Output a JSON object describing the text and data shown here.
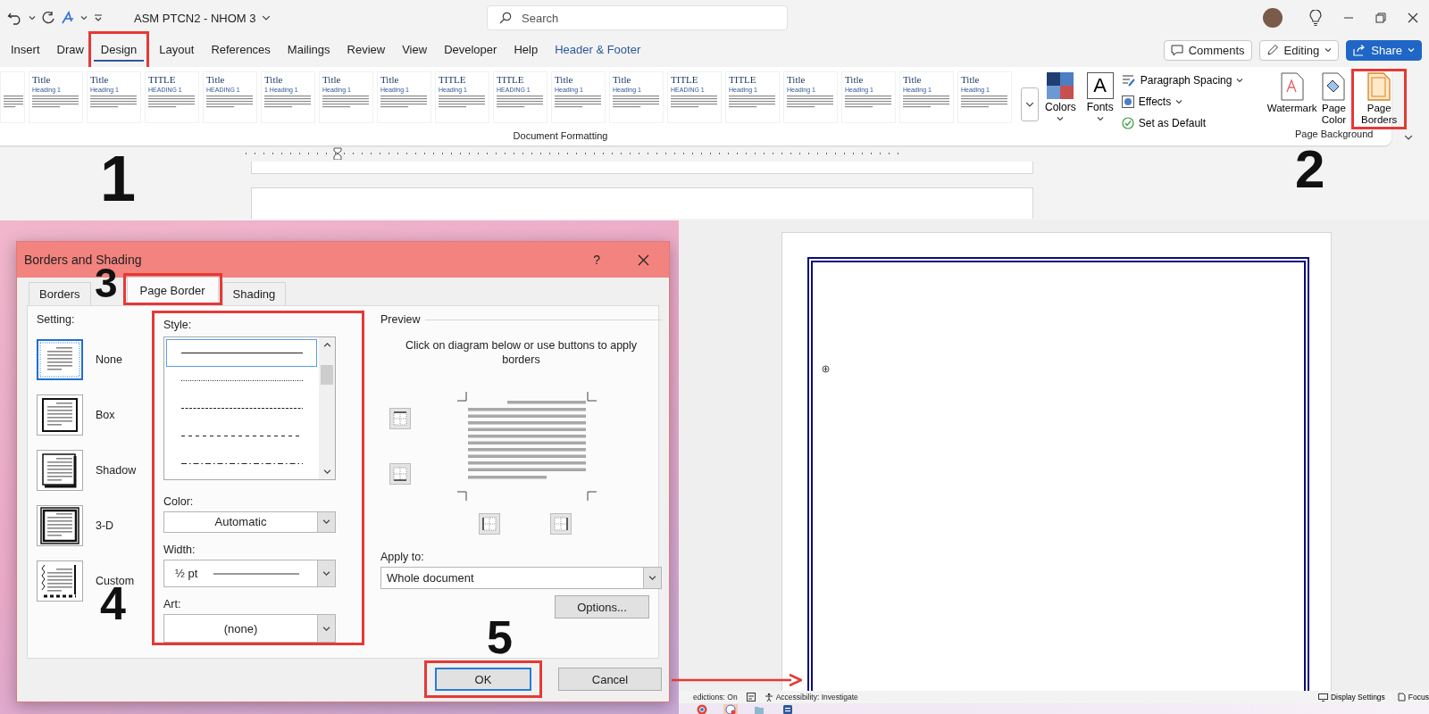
{
  "title_bar": {
    "document_title": "ASM PTCN2 - NHOM 3",
    "search": {
      "placeholder": "Search"
    }
  },
  "ribbon_tabs": [
    {
      "label": "Insert",
      "selected": false,
      "highlighted": false,
      "kind": "standard"
    },
    {
      "label": "Draw",
      "selected": false,
      "highlighted": false,
      "kind": "standard"
    },
    {
      "label": "Design",
      "selected": true,
      "highlighted": true,
      "kind": "standard"
    },
    {
      "label": "Layout",
      "selected": false,
      "highlighted": false,
      "kind": "standard"
    },
    {
      "label": "References",
      "selected": false,
      "highlighted": false,
      "kind": "standard"
    },
    {
      "label": "Mailings",
      "selected": false,
      "highlighted": false,
      "kind": "standard"
    },
    {
      "label": "Review",
      "selected": false,
      "highlighted": false,
      "kind": "standard"
    },
    {
      "label": "View",
      "selected": false,
      "highlighted": false,
      "kind": "standard"
    },
    {
      "label": "Developer",
      "selected": false,
      "highlighted": false,
      "kind": "standard"
    },
    {
      "label": "Help",
      "selected": false,
      "highlighted": false,
      "kind": "standard"
    },
    {
      "label": "Header & Footer",
      "selected": false,
      "highlighted": false,
      "kind": "contextual"
    }
  ],
  "header_buttons": [
    {
      "label": "Comments",
      "kind": "comments"
    },
    {
      "label": "Editing",
      "kind": "editing"
    },
    {
      "label": "Share",
      "kind": "share"
    }
  ],
  "style_gallery": {
    "group_label": "Document Formatting",
    "styles": [
      {
        "kind": "partial"
      },
      {
        "kind": "full",
        "title": "Title",
        "heading": "Heading 1"
      },
      {
        "kind": "full",
        "title": "Title",
        "heading": "Heading 1"
      },
      {
        "kind": "full",
        "title": "TITLE",
        "heading": "HEADING 1"
      },
      {
        "kind": "full",
        "title": "Title",
        "heading": "HEADING 1"
      },
      {
        "kind": "full",
        "title": "Title",
        "heading": "1 Heading 1"
      },
      {
        "kind": "full",
        "title": "Title",
        "heading": "Heading 1"
      },
      {
        "kind": "full",
        "title": "Title",
        "heading": "Heading 1"
      },
      {
        "kind": "full",
        "title": "TITLE",
        "heading": "Heading 1"
      },
      {
        "kind": "full",
        "title": "TITLE",
        "heading": "HEADING 1"
      },
      {
        "kind": "full",
        "title": "Title",
        "heading": "Heading 1"
      },
      {
        "kind": "full",
        "title": "Title",
        "heading": "Heading 1"
      },
      {
        "kind": "full",
        "title": "TITLE",
        "heading": "HEADING 1"
      },
      {
        "kind": "full",
        "title": "TITLE",
        "heading": "Heading 1"
      },
      {
        "kind": "full",
        "title": "Title",
        "heading": "Heading 1"
      },
      {
        "kind": "full",
        "title": "Title",
        "heading": "Heading 1"
      },
      {
        "kind": "full",
        "title": "Title",
        "heading": "Heading 1"
      },
      {
        "kind": "full",
        "title": "Title",
        "heading": "Heading 1"
      }
    ]
  },
  "theme_buttons": [
    {
      "label": "Colors",
      "kind": "colors"
    },
    {
      "label": "Fonts",
      "kind": "fonts",
      "glyph": "A"
    }
  ],
  "format_options": [
    {
      "label": "Paragraph Spacing",
      "kind": "spacing",
      "dropdown": true
    },
    {
      "label": "Effects",
      "kind": "effects",
      "dropdown": true
    },
    {
      "label": "Set as Default",
      "kind": "default",
      "dropdown": false
    }
  ],
  "page_background": {
    "group_label": "Page Background",
    "buttons": [
      {
        "label": "Watermark",
        "kind": "watermark",
        "highlighted": false
      },
      {
        "label": "Page Color",
        "kind": "color",
        "highlighted": false
      },
      {
        "label": "Page Borders",
        "kind": "borders",
        "highlighted": true
      }
    ]
  },
  "dialog": {
    "title": "Borders and Shading",
    "help_glyph": "?",
    "tabs": [
      {
        "label": "Borders",
        "selected": false,
        "highlighted": false
      },
      {
        "label": "Page Border",
        "selected": true,
        "highlighted": true
      },
      {
        "label": "Shading",
        "selected": false,
        "highlighted": false
      }
    ],
    "setting": {
      "label": "Setting:",
      "options": [
        {
          "label": "None",
          "kind": "none",
          "selected": true
        },
        {
          "label": "Box",
          "kind": "box",
          "selected": false
        },
        {
          "label": "Shadow",
          "kind": "shadow",
          "selected": false
        },
        {
          "label": "3-D",
          "kind": "threed",
          "selected": false
        },
        {
          "label": "Custom",
          "kind": "custom",
          "selected": false
        }
      ]
    },
    "style_group": {
      "highlighted": true,
      "style_label": "Style:",
      "line_styles": [
        {
          "kind": "solid",
          "selected": true
        },
        {
          "kind": "dotted",
          "selected": false
        },
        {
          "kind": "fine-dashed",
          "selected": false
        },
        {
          "kind": "dashed",
          "selected": false
        },
        {
          "kind": "dash-dot",
          "selected": false
        }
      ],
      "color_label": "Color:",
      "color_value": "Automatic",
      "width_label": "Width:",
      "width_value": "½ pt",
      "art_label": "Art:",
      "art_value": "(none)"
    },
    "preview": {
      "label": "Preview",
      "instructions": "Click on diagram below or use buttons to apply borders"
    },
    "apply_to": {
      "label": "Apply to:",
      "value": "Whole document"
    },
    "buttons": [
      {
        "label": "Options...",
        "kind": "options",
        "highlighted": false,
        "default": false
      },
      {
        "label": "OK",
        "kind": "ok",
        "highlighted": true,
        "default": true
      },
      {
        "label": "Cancel",
        "kind": "cancel",
        "highlighted": false,
        "default": false
      }
    ]
  },
  "step_markers": [
    "1",
    "2",
    "3",
    "4",
    "5"
  ],
  "status_bar": {
    "left_items": [
      {
        "text": "edictions: On",
        "kind": "predictions"
      },
      {
        "text": "Accessibility: Investigate",
        "kind": "accessibility"
      }
    ],
    "right_items": [
      {
        "text": "Display Settings",
        "kind": "display"
      },
      {
        "text": "Focus",
        "kind": "focus"
      }
    ]
  },
  "taskbar": {
    "apps": [
      {
        "kind": "browser",
        "selected": false
      },
      {
        "kind": "app",
        "selected": true
      },
      {
        "kind": "files",
        "selected": false
      },
      {
        "kind": "word",
        "selected": false
      }
    ]
  }
}
